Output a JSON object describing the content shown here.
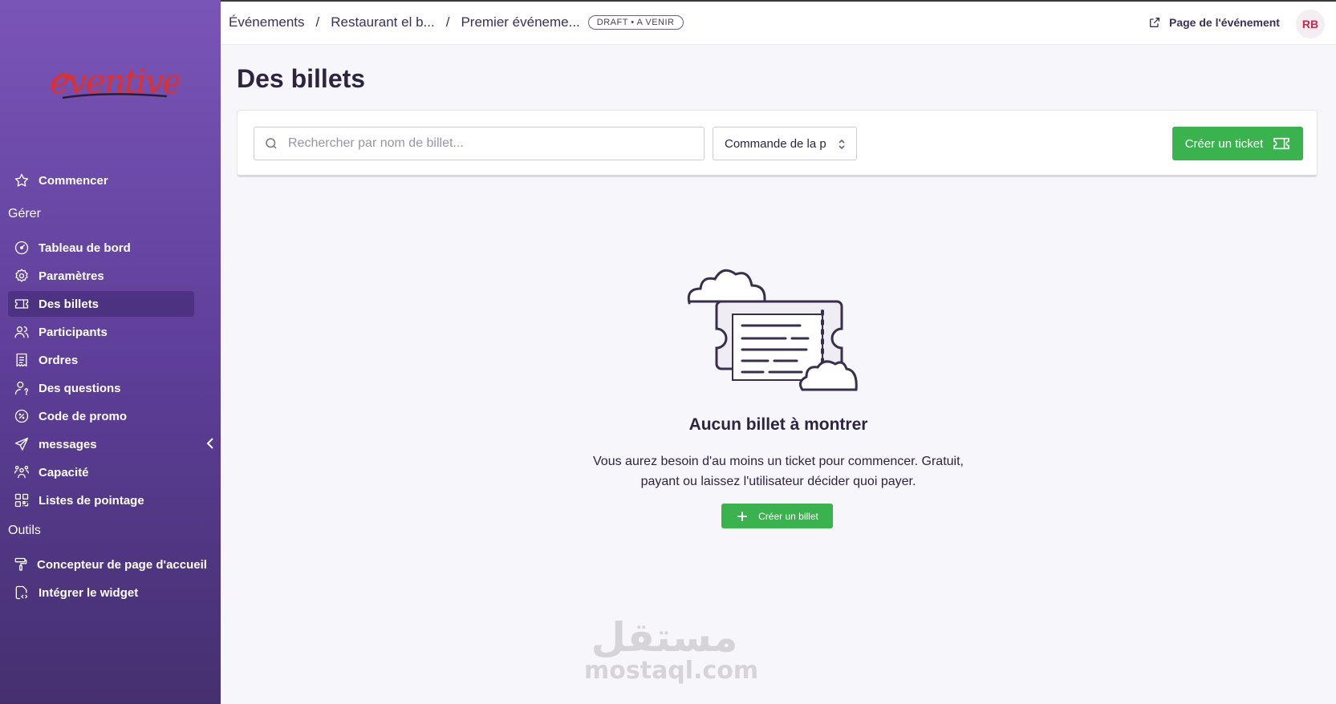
{
  "brand": {
    "logo_text": "eventive"
  },
  "sidebar": {
    "start_item": {
      "label": "Commencer",
      "icon": "star-icon"
    },
    "section_manage": "Gérer",
    "manage_items": [
      {
        "label": "Tableau de bord",
        "icon": "dashboard-icon"
      },
      {
        "label": "Paramètres",
        "icon": "gear-icon"
      },
      {
        "label": "Des billets",
        "icon": "ticket-icon",
        "active": true
      },
      {
        "label": "Participants",
        "icon": "users-icon"
      },
      {
        "label": "Ordres",
        "icon": "receipt-icon"
      },
      {
        "label": "Des questions",
        "icon": "user-question-icon"
      },
      {
        "label": "Code de promo",
        "icon": "discount-icon"
      },
      {
        "label": "messages",
        "icon": "send-icon"
      },
      {
        "label": "Capacité",
        "icon": "group-icon"
      },
      {
        "label": "Listes de pointage",
        "icon": "qr-code-icon"
      }
    ],
    "section_tools": "Outils",
    "tools_items": [
      {
        "label": "Concepteur de page d'accueil",
        "icon": "paint-roller-icon"
      },
      {
        "label": "Intégrer le widget",
        "icon": "embed-icon"
      }
    ]
  },
  "header": {
    "breadcrumbs": [
      "Événements",
      "Restaurant el b...",
      "Premier événeme..."
    ],
    "separator": "/",
    "status_badge": "DRAFT • A VENIR",
    "event_page_link": "Page de l'événement",
    "avatar_initials": "RB"
  },
  "main": {
    "title": "Des billets",
    "search_placeholder": "Rechercher par nom de billet...",
    "sort_select_value": "Commande de la page",
    "create_ticket_button": "Créer un ticket",
    "empty_state": {
      "title": "Aucun billet à montrer",
      "description": "Vous aurez besoin d'au moins un ticket pour commencer. Gratuit, payant ou laissez l'utilisateur décider quoi payer.",
      "button": "Créer un billet"
    }
  },
  "watermark": {
    "arabic": "مستقل",
    "latin": "mostaql.com"
  },
  "colors": {
    "sidebar_top": "#7a55b8",
    "sidebar_bottom": "#45306f",
    "accent_green": "#3ab24e",
    "avatar_text": "#c42a4b"
  }
}
